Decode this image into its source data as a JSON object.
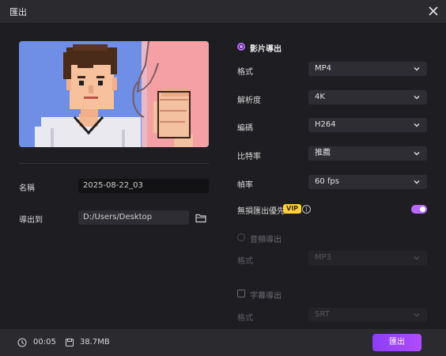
{
  "window": {
    "title": "匯出"
  },
  "left": {
    "name_label": "名稱",
    "name_value": "2025-08-22_03",
    "export_to_label": "導出到",
    "path_value": "D:/Users/Desktop"
  },
  "right": {
    "video_export_label": "影片導出",
    "format_label": "格式",
    "format_value": "MP4",
    "resolution_label": "解析度",
    "resolution_value": "4K",
    "codec_label": "編碼",
    "codec_value": "H264",
    "bitrate_label": "比特率",
    "bitrate_value": "推薦",
    "framerate_label": "幀率",
    "framerate_value": "60  fps",
    "lossless_label": "無損匯出優先",
    "vip_badge": "VIP",
    "lossless_enabled": true,
    "audio_export_label": "音頻導出",
    "audio_format_label": "格式",
    "audio_format_value": "MP3",
    "subtitle_export_label": "字幕導出",
    "subtitle_format_label": "格式",
    "subtitle_format_value": "SRT"
  },
  "footer": {
    "duration": "00:05",
    "file_size": "38.7MB",
    "export_button": "匯出"
  },
  "colors": {
    "accent": "#b967ff",
    "vip": "#ffcf3c"
  }
}
